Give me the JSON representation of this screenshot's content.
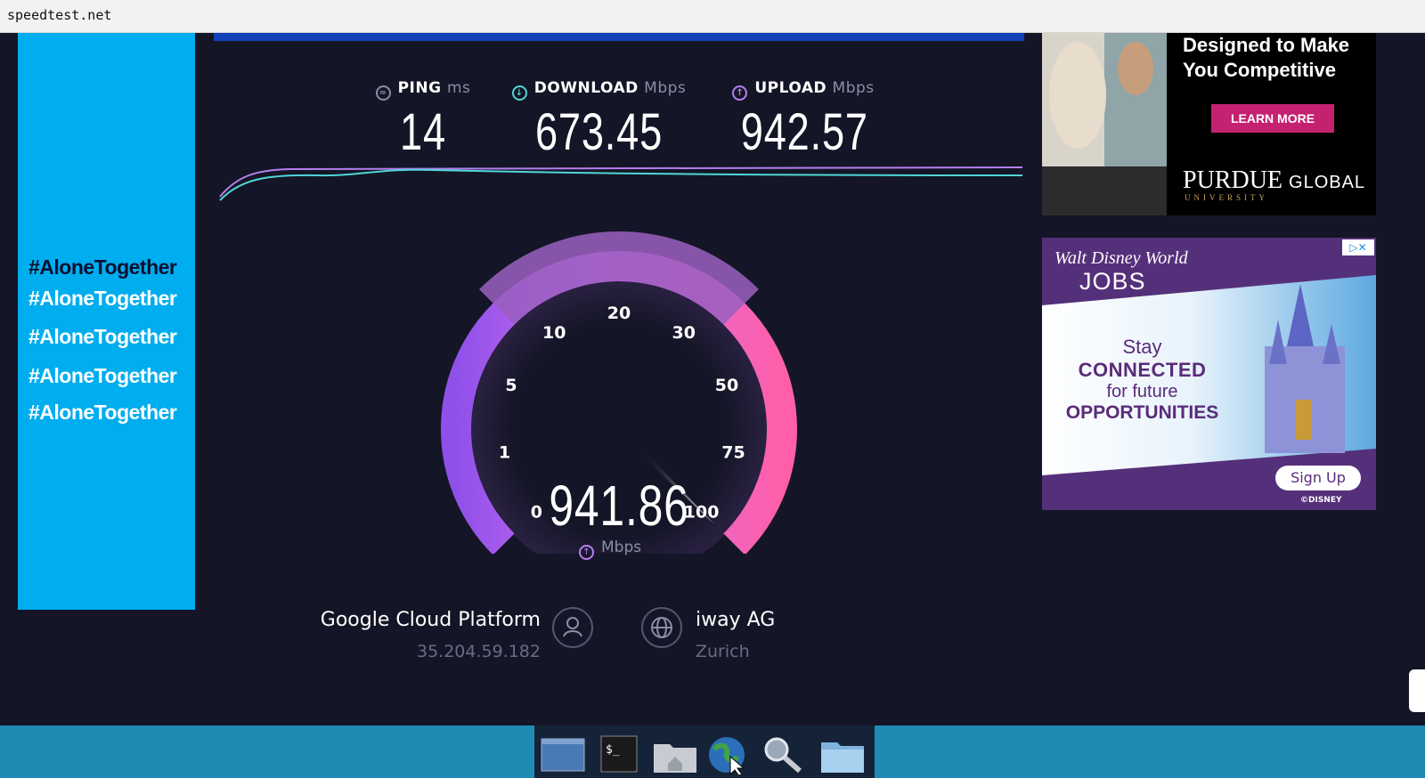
{
  "browser": {
    "url": "speedtest.net"
  },
  "left_ad": {
    "hashtags": [
      "#AloneTogether",
      "#AloneTogether",
      "#AloneTogether",
      "#AloneTogether",
      "#AloneTogether"
    ]
  },
  "metrics": {
    "ping": {
      "label": "PING",
      "unit": "ms",
      "value": "14"
    },
    "download": {
      "label": "DOWNLOAD",
      "unit": "Mbps",
      "value": "673.45"
    },
    "upload": {
      "label": "UPLOAD",
      "unit": "Mbps",
      "value": "942.57"
    }
  },
  "gauge": {
    "ticks": [
      "0",
      "1",
      "5",
      "10",
      "20",
      "30",
      "50",
      "75",
      "100"
    ],
    "value": "941.86",
    "unit": "Mbps",
    "needle_fraction": 1.0
  },
  "server": {
    "host_name": "Google Cloud Platform",
    "host_ip": "35.204.59.182",
    "isp_name": "iway AG",
    "isp_location": "Zurich"
  },
  "ads": {
    "purdue": {
      "headline": [
        "Designed to Make",
        "You Competitive"
      ],
      "cta": "LEARN MORE",
      "brand": "PURDUE",
      "brand_sub": "UNIVERSITY",
      "brand_right": "GLOBAL"
    },
    "disney": {
      "brand": "Walt Disney World",
      "jobs": "JOBS",
      "line1": "Stay",
      "line2": "CONNECTED",
      "line3": "for future",
      "line4": "OPPORTUNITIES",
      "cta": "Sign Up",
      "footer": "©DISNEY"
    }
  },
  "colors": {
    "background": "#141526",
    "download_accent": "#4fd6d6",
    "upload_accent": "#b57ef0",
    "gauge_pink": "#ff6bb0",
    "left_ad_blue": "#00adee"
  }
}
